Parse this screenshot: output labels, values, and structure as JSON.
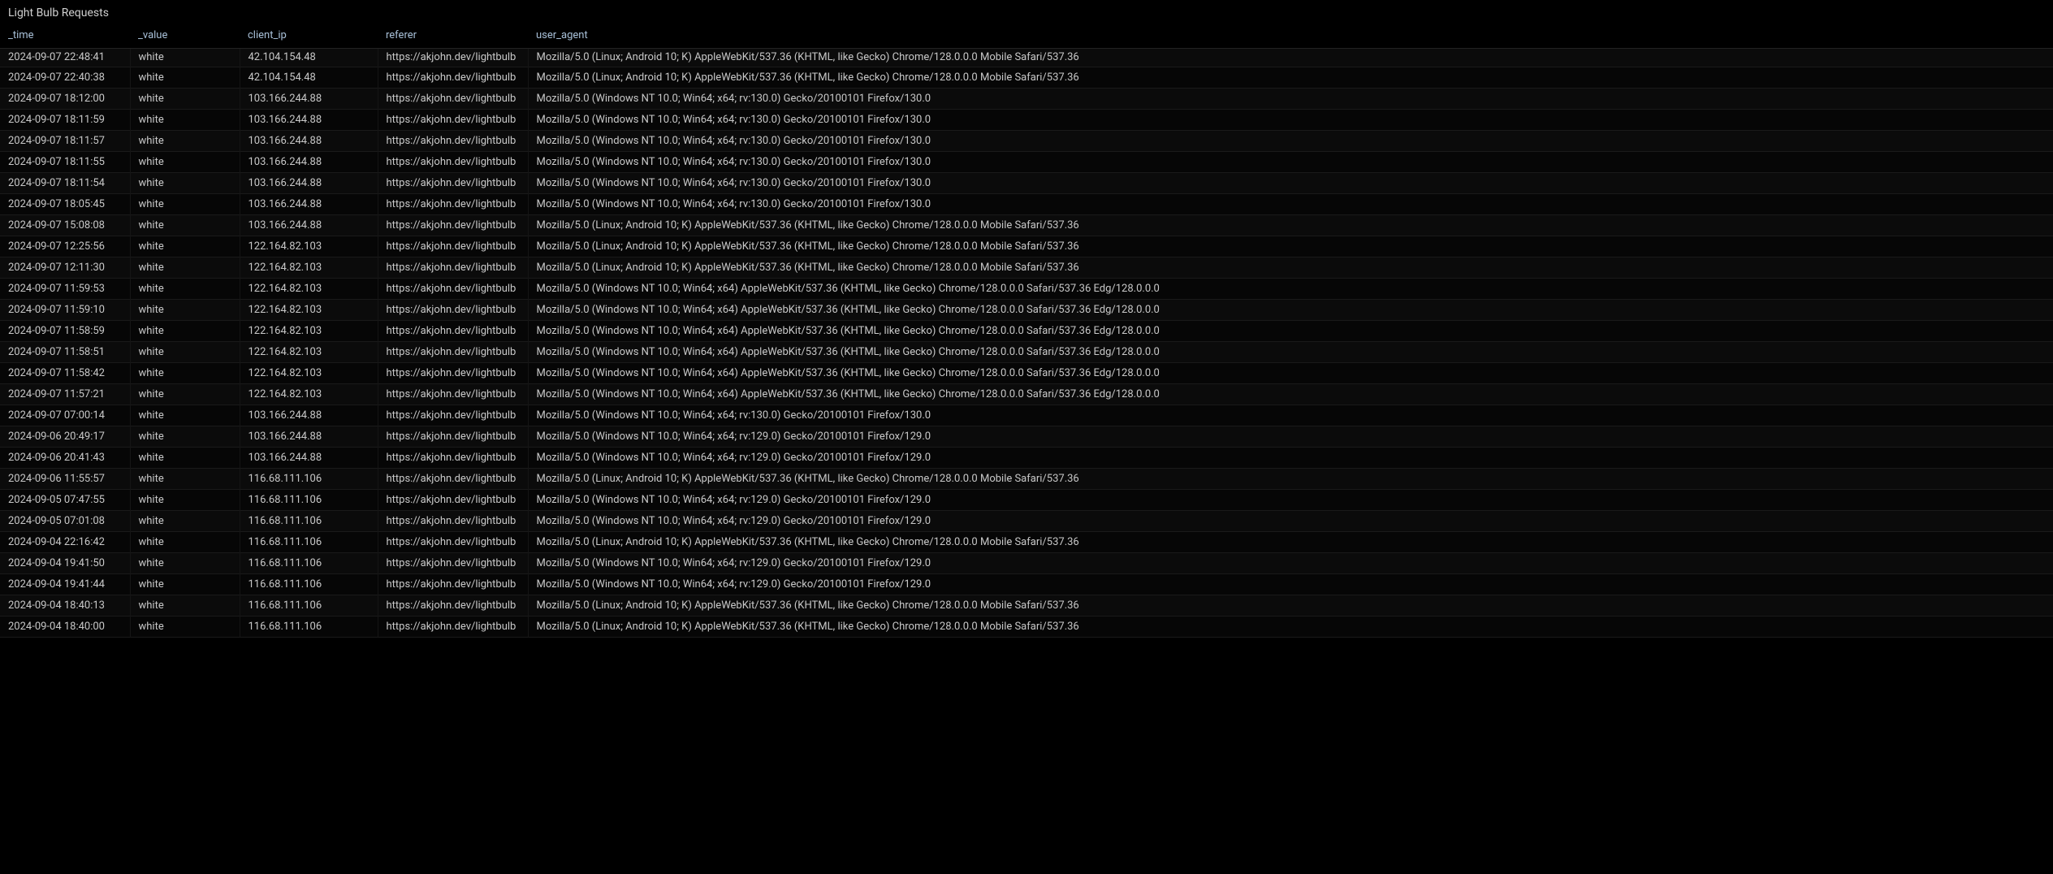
{
  "panel": {
    "title": "Light Bulb Requests"
  },
  "columns": {
    "time": "_time",
    "value": "_value",
    "client_ip": "client_ip",
    "referer": "referer",
    "user_agent": "user_agent"
  },
  "rows": [
    {
      "time": "2024-09-07 22:48:41",
      "value": "white",
      "client_ip": "42.104.154.48",
      "referer": "https://akjohn.dev/lightbulb",
      "user_agent": "Mozilla/5.0 (Linux; Android 10; K) AppleWebKit/537.36 (KHTML, like Gecko) Chrome/128.0.0.0 Mobile Safari/537.36"
    },
    {
      "time": "2024-09-07 22:40:38",
      "value": "white",
      "client_ip": "42.104.154.48",
      "referer": "https://akjohn.dev/lightbulb",
      "user_agent": "Mozilla/5.0 (Linux; Android 10; K) AppleWebKit/537.36 (KHTML, like Gecko) Chrome/128.0.0.0 Mobile Safari/537.36"
    },
    {
      "time": "2024-09-07 18:12:00",
      "value": "white",
      "client_ip": "103.166.244.88",
      "referer": "https://akjohn.dev/lightbulb",
      "user_agent": "Mozilla/5.0 (Windows NT 10.0; Win64; x64; rv:130.0) Gecko/20100101 Firefox/130.0"
    },
    {
      "time": "2024-09-07 18:11:59",
      "value": "white",
      "client_ip": "103.166.244.88",
      "referer": "https://akjohn.dev/lightbulb",
      "user_agent": "Mozilla/5.0 (Windows NT 10.0; Win64; x64; rv:130.0) Gecko/20100101 Firefox/130.0"
    },
    {
      "time": "2024-09-07 18:11:57",
      "value": "white",
      "client_ip": "103.166.244.88",
      "referer": "https://akjohn.dev/lightbulb",
      "user_agent": "Mozilla/5.0 (Windows NT 10.0; Win64; x64; rv:130.0) Gecko/20100101 Firefox/130.0"
    },
    {
      "time": "2024-09-07 18:11:55",
      "value": "white",
      "client_ip": "103.166.244.88",
      "referer": "https://akjohn.dev/lightbulb",
      "user_agent": "Mozilla/5.0 (Windows NT 10.0; Win64; x64; rv:130.0) Gecko/20100101 Firefox/130.0"
    },
    {
      "time": "2024-09-07 18:11:54",
      "value": "white",
      "client_ip": "103.166.244.88",
      "referer": "https://akjohn.dev/lightbulb",
      "user_agent": "Mozilla/5.0 (Windows NT 10.0; Win64; x64; rv:130.0) Gecko/20100101 Firefox/130.0"
    },
    {
      "time": "2024-09-07 18:05:45",
      "value": "white",
      "client_ip": "103.166.244.88",
      "referer": "https://akjohn.dev/lightbulb",
      "user_agent": "Mozilla/5.0 (Windows NT 10.0; Win64; x64; rv:130.0) Gecko/20100101 Firefox/130.0"
    },
    {
      "time": "2024-09-07 15:08:08",
      "value": "white",
      "client_ip": "103.166.244.88",
      "referer": "https://akjohn.dev/lightbulb",
      "user_agent": "Mozilla/5.0 (Linux; Android 10; K) AppleWebKit/537.36 (KHTML, like Gecko) Chrome/128.0.0.0 Mobile Safari/537.36"
    },
    {
      "time": "2024-09-07 12:25:56",
      "value": "white",
      "client_ip": "122.164.82.103",
      "referer": "https://akjohn.dev/lightbulb",
      "user_agent": "Mozilla/5.0 (Linux; Android 10; K) AppleWebKit/537.36 (KHTML, like Gecko) Chrome/128.0.0.0 Mobile Safari/537.36"
    },
    {
      "time": "2024-09-07 12:11:30",
      "value": "white",
      "client_ip": "122.164.82.103",
      "referer": "https://akjohn.dev/lightbulb",
      "user_agent": "Mozilla/5.0 (Linux; Android 10; K) AppleWebKit/537.36 (KHTML, like Gecko) Chrome/128.0.0.0 Mobile Safari/537.36"
    },
    {
      "time": "2024-09-07 11:59:53",
      "value": "white",
      "client_ip": "122.164.82.103",
      "referer": "https://akjohn.dev/lightbulb",
      "user_agent": "Mozilla/5.0 (Windows NT 10.0; Win64; x64) AppleWebKit/537.36 (KHTML, like Gecko) Chrome/128.0.0.0 Safari/537.36 Edg/128.0.0.0"
    },
    {
      "time": "2024-09-07 11:59:10",
      "value": "white",
      "client_ip": "122.164.82.103",
      "referer": "https://akjohn.dev/lightbulb",
      "user_agent": "Mozilla/5.0 (Windows NT 10.0; Win64; x64) AppleWebKit/537.36 (KHTML, like Gecko) Chrome/128.0.0.0 Safari/537.36 Edg/128.0.0.0"
    },
    {
      "time": "2024-09-07 11:58:59",
      "value": "white",
      "client_ip": "122.164.82.103",
      "referer": "https://akjohn.dev/lightbulb",
      "user_agent": "Mozilla/5.0 (Windows NT 10.0; Win64; x64) AppleWebKit/537.36 (KHTML, like Gecko) Chrome/128.0.0.0 Safari/537.36 Edg/128.0.0.0"
    },
    {
      "time": "2024-09-07 11:58:51",
      "value": "white",
      "client_ip": "122.164.82.103",
      "referer": "https://akjohn.dev/lightbulb",
      "user_agent": "Mozilla/5.0 (Windows NT 10.0; Win64; x64) AppleWebKit/537.36 (KHTML, like Gecko) Chrome/128.0.0.0 Safari/537.36 Edg/128.0.0.0"
    },
    {
      "time": "2024-09-07 11:58:42",
      "value": "white",
      "client_ip": "122.164.82.103",
      "referer": "https://akjohn.dev/lightbulb",
      "user_agent": "Mozilla/5.0 (Windows NT 10.0; Win64; x64) AppleWebKit/537.36 (KHTML, like Gecko) Chrome/128.0.0.0 Safari/537.36 Edg/128.0.0.0"
    },
    {
      "time": "2024-09-07 11:57:21",
      "value": "white",
      "client_ip": "122.164.82.103",
      "referer": "https://akjohn.dev/lightbulb",
      "user_agent": "Mozilla/5.0 (Windows NT 10.0; Win64; x64) AppleWebKit/537.36 (KHTML, like Gecko) Chrome/128.0.0.0 Safari/537.36 Edg/128.0.0.0"
    },
    {
      "time": "2024-09-07 07:00:14",
      "value": "white",
      "client_ip": "103.166.244.88",
      "referer": "https://akjohn.dev/lightbulb",
      "user_agent": "Mozilla/5.0 (Windows NT 10.0; Win64; x64; rv:130.0) Gecko/20100101 Firefox/130.0"
    },
    {
      "time": "2024-09-06 20:49:17",
      "value": "white",
      "client_ip": "103.166.244.88",
      "referer": "https://akjohn.dev/lightbulb",
      "user_agent": "Mozilla/5.0 (Windows NT 10.0; Win64; x64; rv:129.0) Gecko/20100101 Firefox/129.0"
    },
    {
      "time": "2024-09-06 20:41:43",
      "value": "white",
      "client_ip": "103.166.244.88",
      "referer": "https://akjohn.dev/lightbulb",
      "user_agent": "Mozilla/5.0 (Windows NT 10.0; Win64; x64; rv:129.0) Gecko/20100101 Firefox/129.0"
    },
    {
      "time": "2024-09-06 11:55:57",
      "value": "white",
      "client_ip": "116.68.111.106",
      "referer": "https://akjohn.dev/lightbulb",
      "user_agent": "Mozilla/5.0 (Linux; Android 10; K) AppleWebKit/537.36 (KHTML, like Gecko) Chrome/128.0.0.0 Mobile Safari/537.36"
    },
    {
      "time": "2024-09-05 07:47:55",
      "value": "white",
      "client_ip": "116.68.111.106",
      "referer": "https://akjohn.dev/lightbulb",
      "user_agent": "Mozilla/5.0 (Windows NT 10.0; Win64; x64; rv:129.0) Gecko/20100101 Firefox/129.0"
    },
    {
      "time": "2024-09-05 07:01:08",
      "value": "white",
      "client_ip": "116.68.111.106",
      "referer": "https://akjohn.dev/lightbulb",
      "user_agent": "Mozilla/5.0 (Windows NT 10.0; Win64; x64; rv:129.0) Gecko/20100101 Firefox/129.0"
    },
    {
      "time": "2024-09-04 22:16:42",
      "value": "white",
      "client_ip": "116.68.111.106",
      "referer": "https://akjohn.dev/lightbulb",
      "user_agent": "Mozilla/5.0 (Linux; Android 10; K) AppleWebKit/537.36 (KHTML, like Gecko) Chrome/128.0.0.0 Mobile Safari/537.36"
    },
    {
      "time": "2024-09-04 19:41:50",
      "value": "white",
      "client_ip": "116.68.111.106",
      "referer": "https://akjohn.dev/lightbulb",
      "user_agent": "Mozilla/5.0 (Windows NT 10.0; Win64; x64; rv:129.0) Gecko/20100101 Firefox/129.0"
    },
    {
      "time": "2024-09-04 19:41:44",
      "value": "white",
      "client_ip": "116.68.111.106",
      "referer": "https://akjohn.dev/lightbulb",
      "user_agent": "Mozilla/5.0 (Windows NT 10.0; Win64; x64; rv:129.0) Gecko/20100101 Firefox/129.0"
    },
    {
      "time": "2024-09-04 18:40:13",
      "value": "white",
      "client_ip": "116.68.111.106",
      "referer": "https://akjohn.dev/lightbulb",
      "user_agent": "Mozilla/5.0 (Linux; Android 10; K) AppleWebKit/537.36 (KHTML, like Gecko) Chrome/128.0.0.0 Mobile Safari/537.36"
    },
    {
      "time": "2024-09-04 18:40:00",
      "value": "white",
      "client_ip": "116.68.111.106",
      "referer": "https://akjohn.dev/lightbulb",
      "user_agent": "Mozilla/5.0 (Linux; Android 10; K) AppleWebKit/537.36 (KHTML, like Gecko) Chrome/128.0.0.0 Mobile Safari/537.36"
    }
  ]
}
